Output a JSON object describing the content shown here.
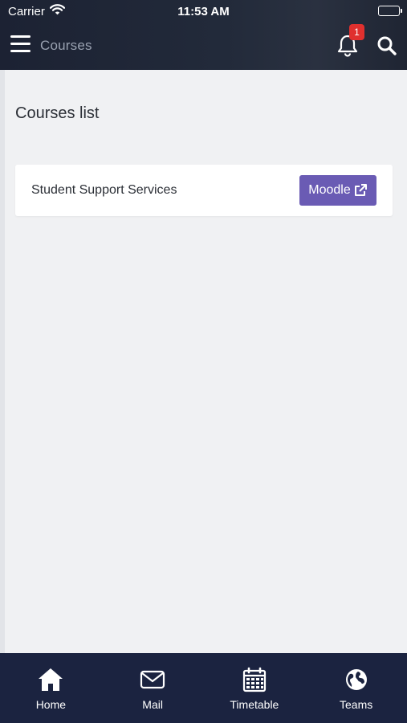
{
  "status_bar": {
    "carrier": "Carrier",
    "time": "11:53 AM"
  },
  "header": {
    "title": "Courses",
    "notification_count": "1"
  },
  "page": {
    "section_title": "Courses list"
  },
  "courses": [
    {
      "name": "Student Support Services",
      "button_label": "Moodle"
    }
  ],
  "tabbar": {
    "tabs": [
      {
        "label": "Home",
        "icon": "home-icon"
      },
      {
        "label": "Mail",
        "icon": "mail-icon"
      },
      {
        "label": "Timetable",
        "icon": "calendar-icon"
      },
      {
        "label": "Teams",
        "icon": "globe-icon"
      }
    ]
  },
  "colors": {
    "header_bg": "#1f2533",
    "tabbar_bg": "#1b2340",
    "accent_button": "#6a5bb4",
    "badge": "#e0302e",
    "page_bg": "#f0f1f3"
  }
}
